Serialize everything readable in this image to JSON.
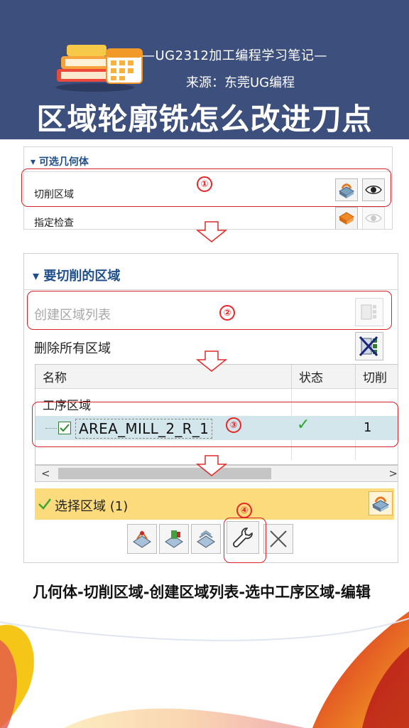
{
  "header": {
    "subtitle": "—UG2312加工编程学习笔记—",
    "source": "来源：东莞UG编程",
    "title": "区域轮廓铣怎么改进刀点"
  },
  "panel1": {
    "section": "可选几何体",
    "row1": "切削区域",
    "row2": "指定检查",
    "marker": "①"
  },
  "panel2": {
    "section": "要切削的区域",
    "create": "创建区域列表",
    "delete": "删除所有区域",
    "marker_create": "②",
    "table": {
      "col_name": "名称",
      "col_status": "状态",
      "col_cut": "切削",
      "group": "工序区域",
      "row_name": "AREA_MILL_2_R_1",
      "row_status": "✓",
      "row_cut": "1"
    },
    "marker_row": "③",
    "scroll_left": "<",
    "scroll_right": ">",
    "select_label": "选择区域 (1)",
    "marker_edit": "④"
  },
  "caption": "几何体-切削区域-创建区域列表-选中工序区域-编辑",
  "colors": {
    "header_bg": "#3d4f7d",
    "accent_red": "#e8262a",
    "select_bar": "#fbdb7b",
    "selected_row": "#d3e6ec",
    "section_blue": "#1f4e8c"
  },
  "icons": [
    "cut-area-icon",
    "eye-icon",
    "check-geometry-icon",
    "region-list-icon",
    "delete-all-icon",
    "select-region-icon",
    "wrench-icon",
    "close-icon"
  ]
}
